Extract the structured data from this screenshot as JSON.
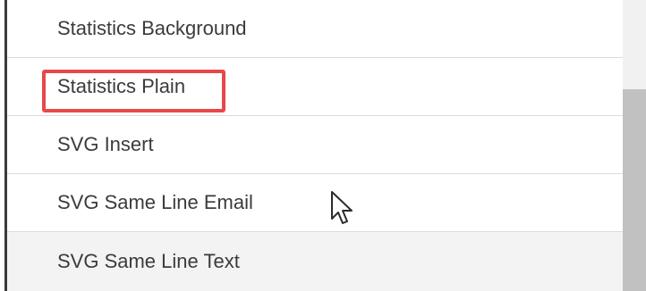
{
  "list": {
    "items": [
      {
        "label": "Statistics Background"
      },
      {
        "label": "Statistics Plain"
      },
      {
        "label": "SVG Insert"
      },
      {
        "label": "SVG Same Line Email"
      },
      {
        "label": "SVG Same Line Text"
      }
    ],
    "highlighted_item": "Statistics Plain"
  },
  "colors": {
    "highlight": "#e8484a",
    "text": "#3b3b3b",
    "row_divider": "#dcdcdc",
    "hover_row": "#f3f3f3",
    "scrollbar_thumb": "#c1c1c1"
  },
  "icons": {
    "cursor": "mouse-pointer-icon"
  }
}
